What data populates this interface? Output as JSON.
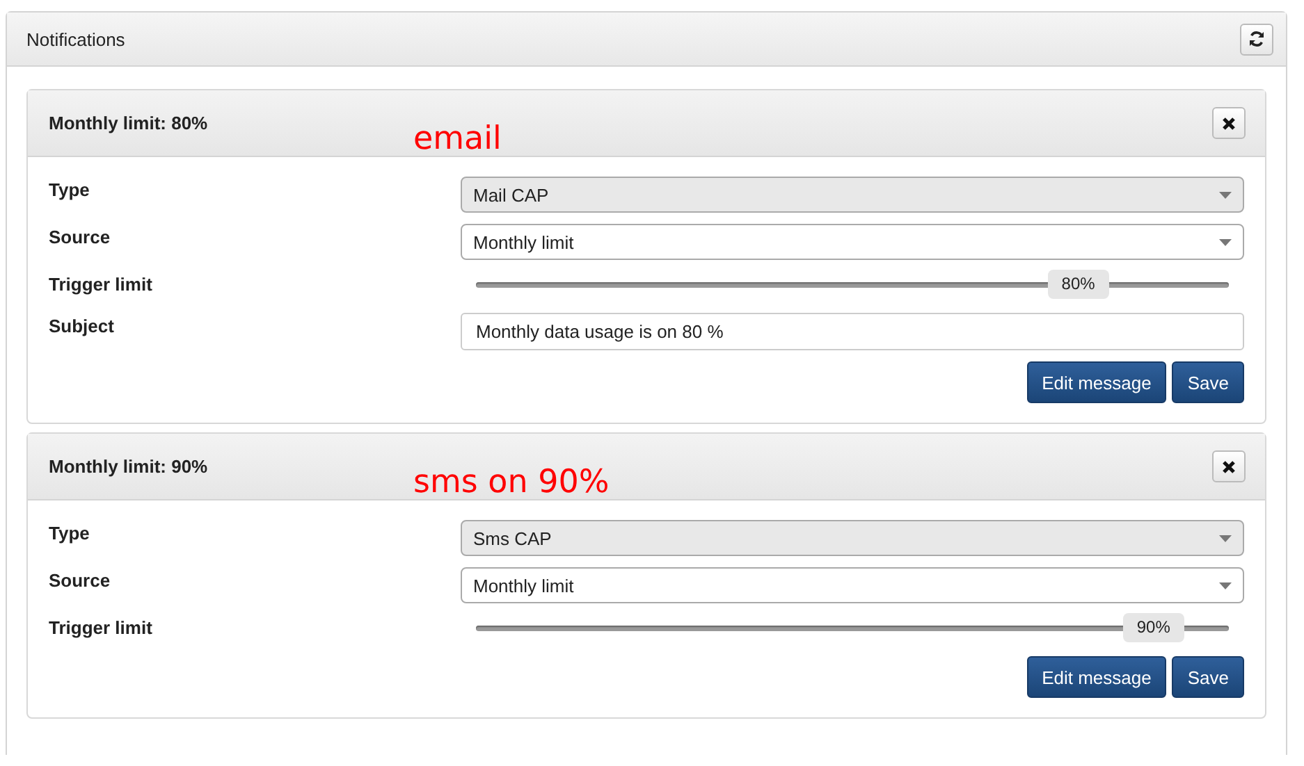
{
  "panel": {
    "title": "Notifications"
  },
  "cards": [
    {
      "title": "Monthly limit: 80%",
      "annotation": "email",
      "fields": [
        {
          "kind": "select",
          "label": "Type",
          "value": "Mail CAP",
          "disabled": true
        },
        {
          "kind": "select",
          "label": "Source",
          "value": "Monthly limit",
          "disabled": false
        },
        {
          "kind": "slider",
          "label": "Trigger limit",
          "level": 0.8,
          "reading": "80%"
        },
        {
          "kind": "text",
          "label": "Subject",
          "value": "Monthly data usage is on 80 %"
        }
      ],
      "buttons": [
        "Edit message",
        "Save"
      ]
    },
    {
      "title": "Monthly limit: 90%",
      "annotation": "sms on 90%",
      "fields": [
        {
          "kind": "select",
          "label": "Type",
          "value": "Sms CAP",
          "disabled": true
        },
        {
          "kind": "select",
          "label": "Source",
          "value": "Monthly limit",
          "disabled": false
        },
        {
          "kind": "slider",
          "label": "Trigger limit",
          "level": 0.9,
          "reading": "90%"
        }
      ],
      "buttons": [
        "Edit message",
        "Save"
      ]
    }
  ]
}
